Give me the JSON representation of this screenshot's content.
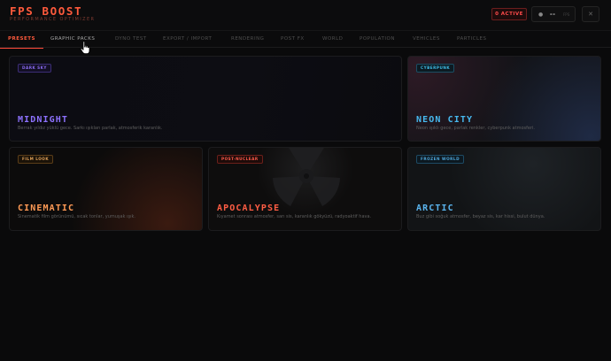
{
  "app": {
    "title": "FPS BOOST",
    "subtitle": "PERFORMANCE OPTIMIZER"
  },
  "header": {
    "active_badge": "0 ACTIVE",
    "fps": {
      "dot": "●",
      "value": "--",
      "unit": "FPS"
    },
    "close_icon": "close-icon",
    "close_glyph": "✕"
  },
  "tabs": [
    {
      "label": "PRESETS",
      "state": "active"
    },
    {
      "label": "GRAPHIC PACKS",
      "state": "hover"
    },
    {
      "label": "DYNO TEST",
      "state": "normal"
    },
    {
      "label": "EXPORT / IMPORT",
      "state": "normal"
    },
    {
      "label": "RENDERING",
      "state": "normal"
    },
    {
      "label": "POST FX",
      "state": "normal"
    },
    {
      "label": "WORLD",
      "state": "normal"
    },
    {
      "label": "POPULATION",
      "state": "normal"
    },
    {
      "label": "VEHICLES",
      "state": "normal"
    },
    {
      "label": "PARTICLES",
      "state": "normal"
    }
  ],
  "presets": [
    {
      "tag": "DARK SKY",
      "name": "MIDNIGHT",
      "description": "Berrak yıldız yüklü gece. Sarkı ışıkları parlak, atmosferik karanlık.",
      "accent": "#8d72ff"
    },
    {
      "tag": "CYBERPUNK",
      "name": "NEON CITY",
      "description": "Neon ışıklı gece, parlak renkler, cyberpunk atmosferi.",
      "accent": "#47b9f0"
    },
    {
      "tag": "FILM LOOK",
      "name": "CINEMATIC",
      "description": "Sinematik film görünümü, sıcak tonlar, yumuşak ışık.",
      "accent": "#ff9a55"
    },
    {
      "tag": "POST-NUCLEAR",
      "name": "APOCALYPSE",
      "description": "Kıyamet sonrası atmosfer, sarı sis, karanlık gökyüzü, radyoaktif hava.",
      "accent": "#ff5d44"
    },
    {
      "tag": "FROZEN WORLD",
      "name": "ARCTIC",
      "description": "Buz gibi soğuk atmosfer, beyaz sis, kar hissi, bulut dünya.",
      "accent": "#5ab4ee"
    }
  ],
  "colors": {
    "brand": "#ff5a3c",
    "active_badge": "#ff4b4b",
    "background": "#0a0a0b"
  }
}
